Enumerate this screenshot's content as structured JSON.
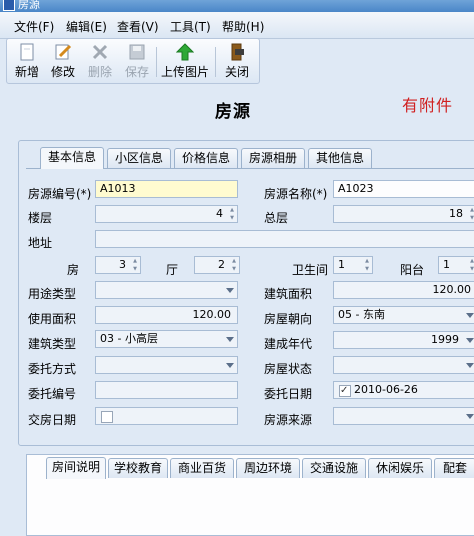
{
  "window": {
    "title": "房源"
  },
  "menu": [
    {
      "label": "文件(F)"
    },
    {
      "label": "编辑(E)"
    },
    {
      "label": "查看(V)"
    },
    {
      "label": "工具(T)"
    },
    {
      "label": "帮助(H)"
    }
  ],
  "toolbar": {
    "new": "新增",
    "edit": "修改",
    "delete": "删除",
    "save": "保存",
    "upload": "上传图片",
    "close": "关闭"
  },
  "form": {
    "title": "房源",
    "attachment_flag": "有附件"
  },
  "tabs": [
    "基本信息",
    "小区信息",
    "价格信息",
    "房源相册",
    "其他信息"
  ],
  "fields": {
    "code_label": "房源编号(*)",
    "code_value": "A1013",
    "name_label": "房源名称(*)",
    "name_value": "A1023",
    "floor_label": "楼层",
    "floor_value": "4",
    "total_floor_label": "总层",
    "total_floor_value": "18",
    "address_label": "地址",
    "address_value": "",
    "room_label": "房",
    "room_value": "3",
    "hall_label": "厅",
    "hall_value": "2",
    "bath_label": "卫生间",
    "bath_value": "1",
    "balcony_label": "阳台",
    "balcony_value": "1",
    "usage_label": "用途类型",
    "usage_value": "",
    "build_area_label": "建筑面积",
    "build_area_value": "120.00",
    "use_area_label": "使用面积",
    "use_area_value": "120.00",
    "orientation_label": "房屋朝向",
    "orientation_value": "05 - 东南",
    "build_type_label": "建筑类型",
    "build_type_value": "03 - 小高层",
    "build_year_label": "建成年代",
    "build_year_value": "1999",
    "entrust_way_label": "委托方式",
    "entrust_way_value": "",
    "house_status_label": "房屋状态",
    "house_status_value": "",
    "entrust_no_label": "委托编号",
    "entrust_no_value": "",
    "entrust_date_label": "委托日期",
    "entrust_date_value": "2010-06-26",
    "handover_label": "交房日期",
    "handover_value": "",
    "source_label": "房源来源",
    "source_value": ""
  },
  "bottom_tabs": [
    "房间说明",
    "学校教育",
    "商业百货",
    "周边环境",
    "交通设施",
    "休闲娱乐",
    "配套"
  ]
}
